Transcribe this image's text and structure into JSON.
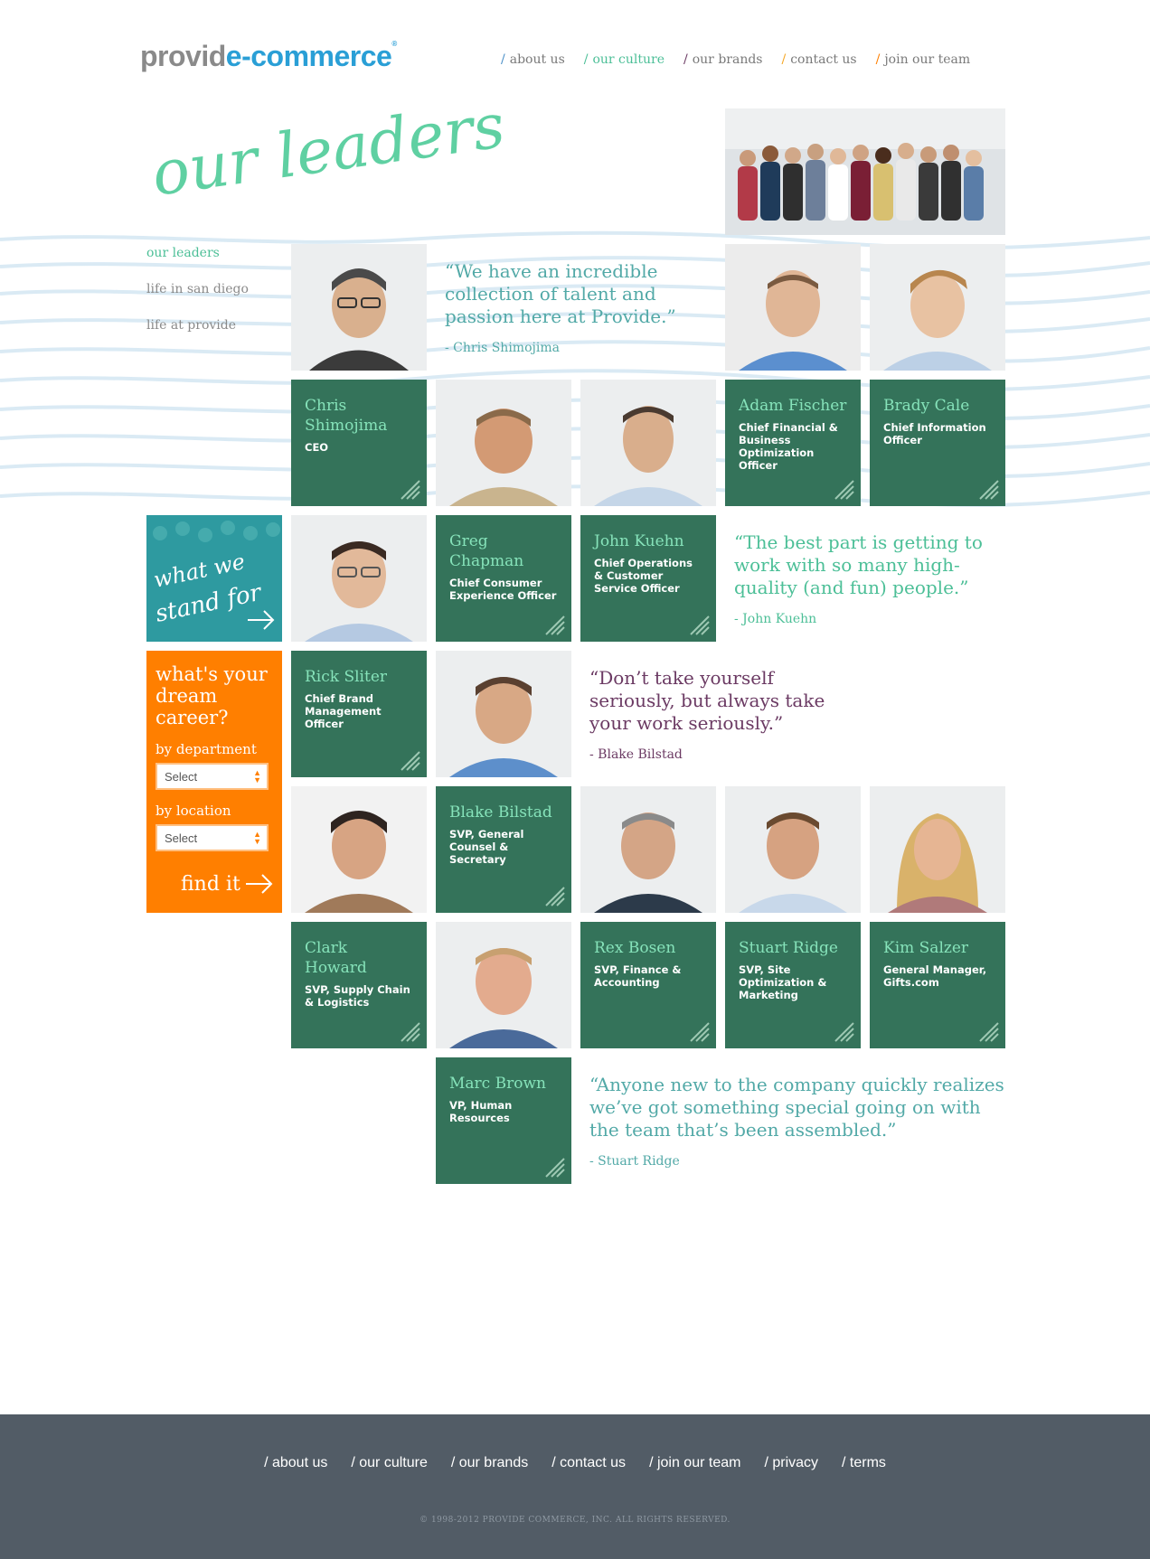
{
  "brand": {
    "logo_part1": "provid",
    "logo_part2": "e-commerce",
    "logo_mark": "®"
  },
  "top_nav": [
    {
      "label": "about us",
      "active": false,
      "slash_color": "#4a8fc7"
    },
    {
      "label": "our culture",
      "active": true,
      "slash_color": "#4cbf97"
    },
    {
      "label": "our brands",
      "active": false,
      "slash_color": "#6b3a63"
    },
    {
      "label": "contact us",
      "active": false,
      "slash_color": "#f5a623"
    },
    {
      "label": "join our team",
      "active": false,
      "slash_color": "#ff7f00"
    }
  ],
  "headline": "our leaders",
  "sub_nav": [
    {
      "label": "our leaders",
      "active": true
    },
    {
      "label": "life in san diego",
      "active": false
    },
    {
      "label": "life at provide",
      "active": false
    }
  ],
  "leaders": [
    {
      "name": "Chris Shimojima",
      "title": "CEO"
    },
    {
      "name": "Adam Fischer",
      "title": "Chief Financial & Business Optimization Officer"
    },
    {
      "name": "Brady Cale",
      "title": "Chief Information Officer"
    },
    {
      "name": "Greg Chapman",
      "title": "Chief Consumer Experience Officer"
    },
    {
      "name": "John Kuehn",
      "title": "Chief Operations & Customer Service Officer"
    },
    {
      "name": "Rick Sliter",
      "title": "Chief Brand Management Officer"
    },
    {
      "name": "Blake Bilstad",
      "title": "SVP, General Counsel & Secretary"
    },
    {
      "name": "Clark Howard",
      "title": "SVP, Supply Chain & Logistics"
    },
    {
      "name": "Rex Bosen",
      "title": "SVP, Finance & Accounting"
    },
    {
      "name": "Stuart Ridge",
      "title": "SVP, Site Optimization & Marketing"
    },
    {
      "name": "Kim Salzer",
      "title": "General Manager, Gifts.com"
    },
    {
      "name": "Marc Brown",
      "title": "VP, Human Resources"
    }
  ],
  "quotes": [
    {
      "text": "“We have an incredible collection of talent and passion here at Provide.”",
      "author": "- Chris Shimojima"
    },
    {
      "text": "“The best part is getting to work with so many high-quality (and fun) people.”",
      "author": "- John Kuehn"
    },
    {
      "text": "“Don’t take yourself seriously, but always take your work seriously.”",
      "author": "- Blake Bilstad"
    },
    {
      "text": "“Anyone new to the company quickly realizes we’ve got something special going on with the team that’s been assembled.”",
      "author": "- Stuart Ridge"
    }
  ],
  "stand_for": {
    "line1": "what we",
    "line2": "stand for"
  },
  "career": {
    "title": "what's your dream career?",
    "dept_label": "by department",
    "dept_value": "Select",
    "loc_label": "by location",
    "loc_value": "Select",
    "button": "find it"
  },
  "footer_nav": [
    "/ about us",
    "/ our culture",
    "/ our brands",
    "/ contact us",
    "/ join our team",
    "/ privacy",
    "/ terms"
  ],
  "copyright": "© 1998-2012 PROVIDE COMMERCE, INC. ALL RIGHTS RESERVED.",
  "colors": {
    "tile_green": "#34735a",
    "name_green": "#86e3ba",
    "accent_green": "#4cbf97",
    "quote_teal": "#52a9a7",
    "quote_purple": "#6b3a63",
    "career_orange": "#ff7f00",
    "footer_gray": "#525c66",
    "logo_blue": "#2a9fd6"
  }
}
